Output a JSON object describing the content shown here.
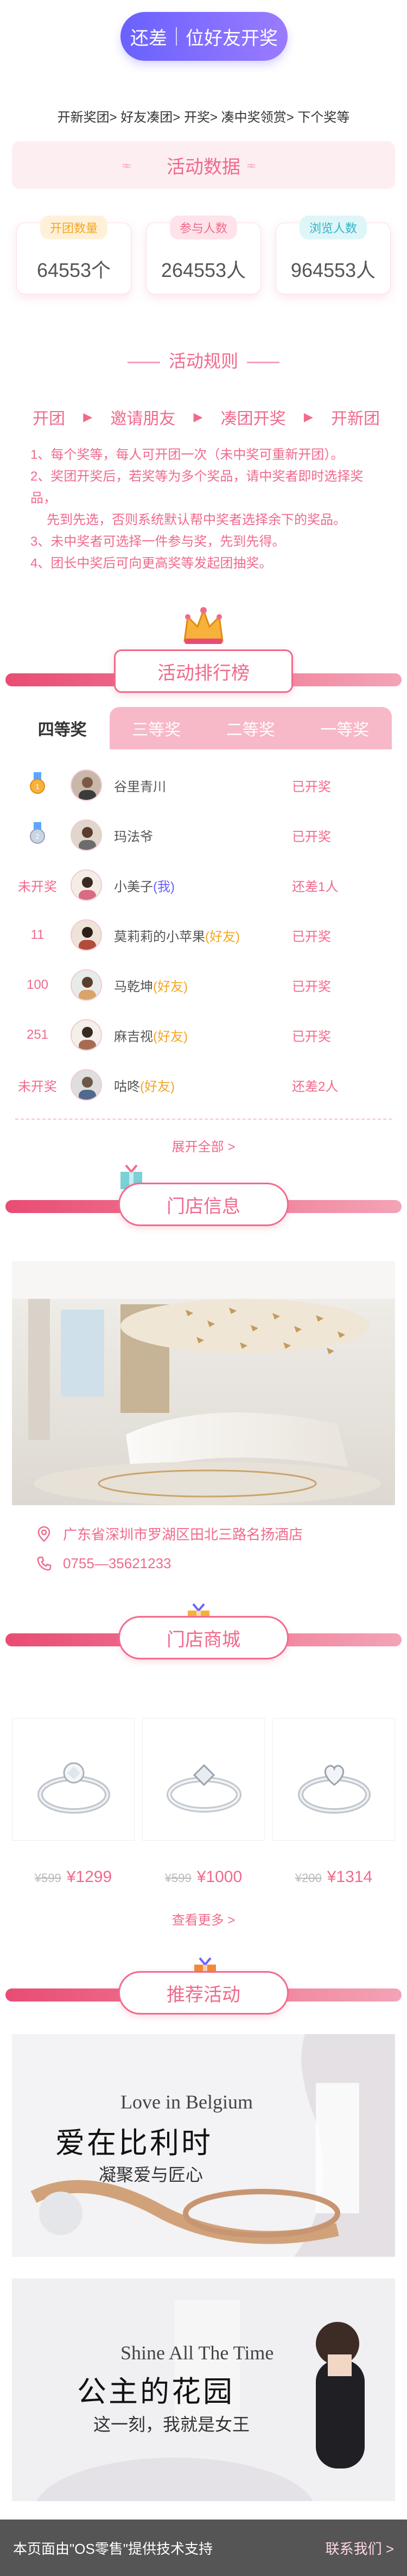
{
  "top_cta": {
    "left": "还差",
    "right": "位好友开奖"
  },
  "flow": "开新奖团> 好友凑团> 开奖> 凑中奖领赏> 下个奖等",
  "activity_data": {
    "title": "活动数据",
    "stats": [
      {
        "label": "开团数量",
        "value": "64553个",
        "color": "#f5a623"
      },
      {
        "label": "参与人数",
        "value": "264553人",
        "color": "#f06a8c"
      },
      {
        "label": "浏览人数",
        "value": "964553人",
        "color": "#2fb3c7"
      }
    ]
  },
  "rules": {
    "title": "活动规则",
    "steps": [
      "开团",
      "邀请朋友",
      "凑团开奖",
      "开新团"
    ],
    "items": [
      "1、每个奖等，每人可开团一次（未中奖可重新开团）。",
      "2、奖团开奖后，若奖等为多个奖品，请中奖者即时选择奖品，",
      "先到先选，否则系统默认帮中奖者选择余下的奖品。",
      "3、未中奖者可选择一件参与奖，先到先得。",
      "4、团长中奖后可向更高奖等发起团抽奖。"
    ]
  },
  "ranking": {
    "title": "活动排行榜",
    "tabs": [
      "四等奖",
      "三等奖",
      "二等奖",
      "一等奖"
    ],
    "rows": [
      {
        "pos": "",
        "medal": "gold",
        "name": "谷里青川",
        "tag": "",
        "status": "已开奖"
      },
      {
        "pos": "",
        "medal": "silver",
        "name": "玛法爷",
        "tag": "",
        "status": "已开奖"
      },
      {
        "pos": "未开奖",
        "medal": "",
        "name": "小美子",
        "tag": "(我)",
        "tag_type": "me",
        "status": "还差1人"
      },
      {
        "pos": "11",
        "medal": "",
        "name": "莫莉莉的小苹果",
        "tag": "(好友)",
        "tag_type": "friend",
        "status": "已开奖"
      },
      {
        "pos": "100",
        "medal": "",
        "name": "马乾坤",
        "tag": "(好友)",
        "tag_type": "friend",
        "status": "已开奖"
      },
      {
        "pos": "251",
        "medal": "",
        "name": "麻吉视",
        "tag": "(好友)",
        "tag_type": "friend",
        "status": "已开奖"
      },
      {
        "pos": "未开奖",
        "medal": "",
        "name": "咕咚",
        "tag": "(好友)",
        "tag_type": "friend",
        "status": "还差2人"
      }
    ],
    "expand": "展开全部 >"
  },
  "store": {
    "title": "门店信息",
    "address": "广东省深圳市罗湖区田北三路名扬酒店",
    "phone": "0755—35621233"
  },
  "mall": {
    "title": "门店商城",
    "products": [
      {
        "old": "¥599",
        "price": "¥1299"
      },
      {
        "old": "¥599",
        "price": "¥1000"
      },
      {
        "old": "¥200",
        "price": "¥1314"
      }
    ],
    "more": "查看更多 >"
  },
  "recommend": {
    "title": "推荐活动",
    "banners": [
      {
        "en": "Love in Belgium",
        "cn": "爱在比利时",
        "sub": "凝聚爱与匠心"
      },
      {
        "en": "Shine All The Time",
        "cn": "公主的花园",
        "sub": "这一刻，我就是女王"
      }
    ]
  },
  "footer": {
    "text": "本页面由\"OS零售\"提供技术支持",
    "link": "联系我们 >"
  },
  "colors": {
    "accent": "#f06a8c",
    "cta": "#6a61ff",
    "friend_tag": "#f5a623",
    "me_tag": "#6a61ff"
  }
}
